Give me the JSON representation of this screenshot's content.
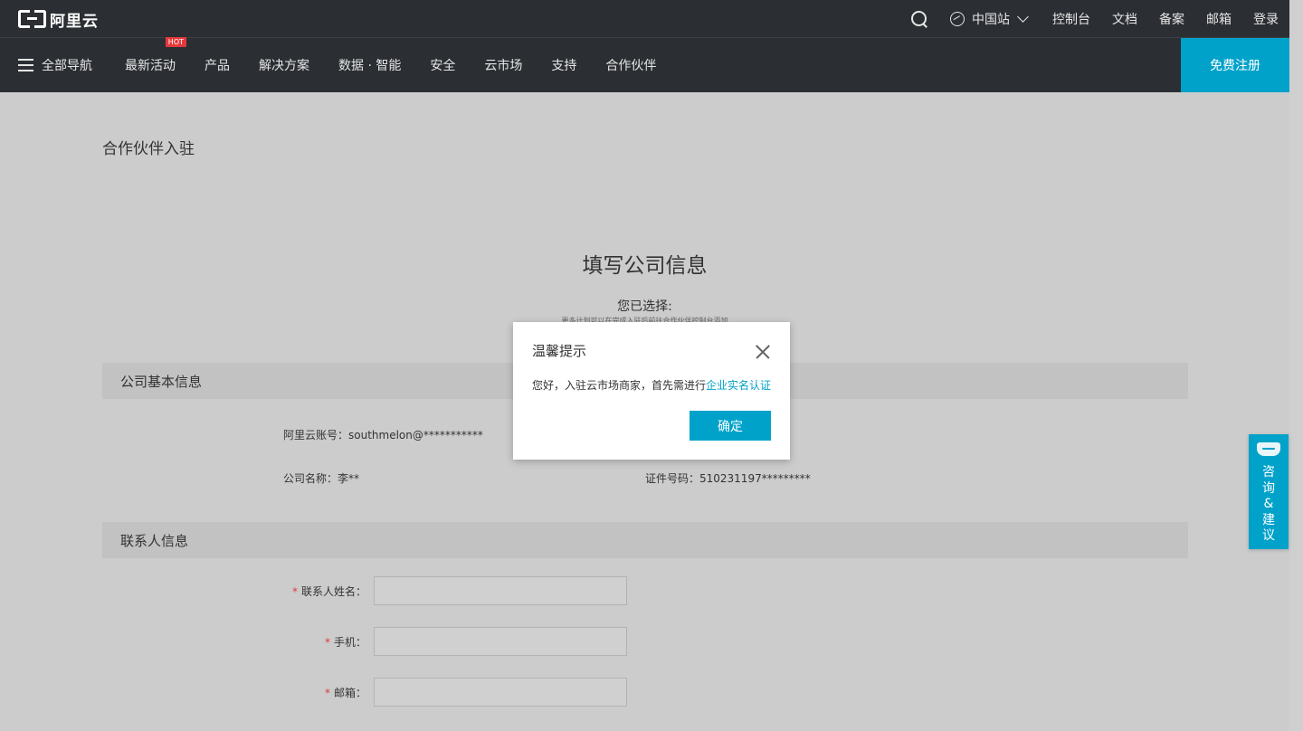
{
  "header": {
    "logo_text": "阿里云",
    "region": "中国站",
    "links": [
      "控制台",
      "文档",
      "备案",
      "邮箱",
      "登录"
    ]
  },
  "nav": {
    "all_nav": "全部导航",
    "items": [
      {
        "label": "最新活动",
        "badge": "HOT"
      },
      {
        "label": "产品"
      },
      {
        "label": "解决方案"
      },
      {
        "label": "数据 · 智能"
      },
      {
        "label": "安全"
      },
      {
        "label": "云市场"
      },
      {
        "label": "支持"
      },
      {
        "label": "合作伙伴"
      }
    ],
    "signup": "免费注册"
  },
  "page": {
    "breadcrumb": "合作伙伴入驻",
    "heading": "填写公司信息",
    "selected_label": "您已选择:",
    "selected_sub": "更多计划可以在完成入驻后前往合作伙伴控制台添加"
  },
  "sections": {
    "company_title": "公司基本信息",
    "contact_title": "联系人信息"
  },
  "company_info": {
    "account": "阿里云账号：southmelon@***********",
    "company_name": "公司名称：李**",
    "id_number": "证件号码：510231197*********"
  },
  "contact_form": {
    "name_label": "联系人姓名：",
    "phone_label": "手机：",
    "email_label": "邮箱：",
    "required_mark": "*"
  },
  "modal": {
    "title": "温馨提示",
    "message": "您好，入驻云市场商家，首先需进行",
    "link": "企业实名认证",
    "confirm": "确定"
  },
  "feedback": {
    "chars": [
      "咨",
      "询",
      "&",
      "建",
      "议"
    ]
  }
}
